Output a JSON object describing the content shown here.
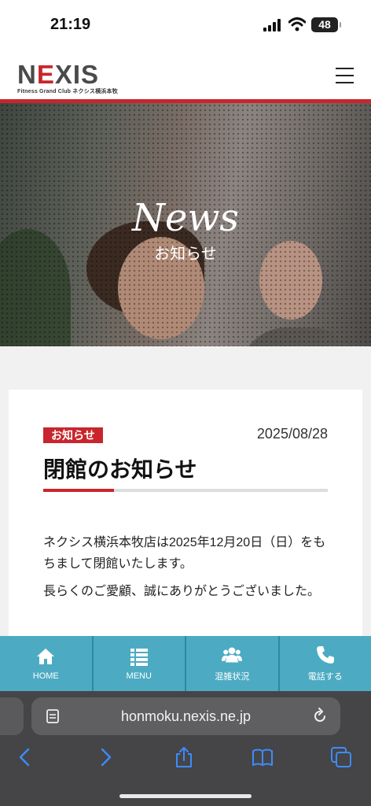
{
  "status_bar": {
    "time": "21:19",
    "battery": "48"
  },
  "header": {
    "logo_prefix": "N",
    "logo_red": "E",
    "logo_suffix": "XIS",
    "logo_subtitle": "Fitness Grand Club ネクシス横浜本牧"
  },
  "hero": {
    "title": "News",
    "subtitle": "お知らせ"
  },
  "article": {
    "badge": "お知らせ",
    "date": "2025/08/28",
    "title": "閉館のお知らせ",
    "paragraph1": "ネクシス横浜本牧店は2025年12月20日（日）をもちまして閉館いたします。",
    "paragraph2": "長らくのご愛顧、誠にありがとうございました。"
  },
  "bottom_nav": {
    "home": "HOME",
    "menu": "MENU",
    "congestion": "混雑状況",
    "phone": "電話する"
  },
  "browser": {
    "url": "honmoku.nexis.ne.jp"
  },
  "colors": {
    "brand_red": "#c8262c",
    "nav_teal": "#4cabc3"
  }
}
